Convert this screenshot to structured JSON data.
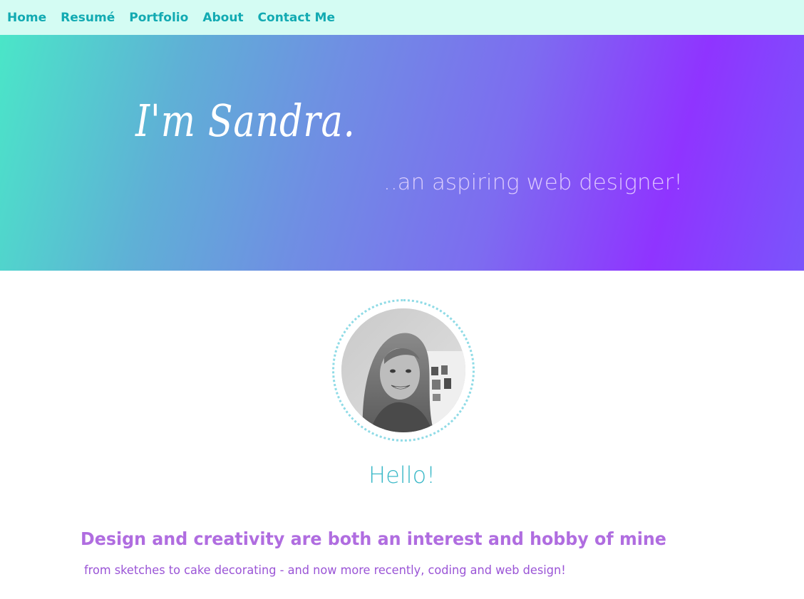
{
  "nav": {
    "items": [
      {
        "label": "Home"
      },
      {
        "label": "Resumé"
      },
      {
        "label": "Portfolio"
      },
      {
        "label": "About"
      },
      {
        "label": "Contact Me"
      }
    ]
  },
  "hero": {
    "title": "I'm Sandra.",
    "subtitle": "..an aspiring web designer!"
  },
  "profile": {
    "greeting": "Hello!"
  },
  "intro": {
    "heading": "Design and creativity are both an interest and hobby of mine",
    "body": "from sketches to cake decorating - and now more recently, coding and web design!"
  },
  "colors": {
    "nav_bg": "#d4fcf3",
    "nav_link": "#12aab2",
    "gradient_start": "#4ae6c8",
    "gradient_end": "#8f34ff",
    "greeting": "#3cb9c8",
    "heading": "#b06de0",
    "body": "#9a54d6"
  }
}
